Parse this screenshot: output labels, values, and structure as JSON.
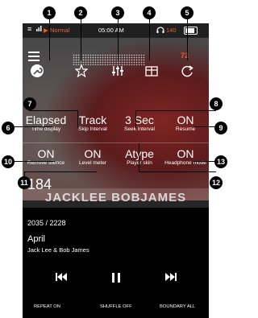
{
  "status": {
    "list_icon": "list-icon",
    "signal_icon": "signal-icon",
    "play_icon": "play-indicator-icon",
    "mode": "Normal",
    "time": "05:00 AM",
    "headphone_icon": "headphone-icon",
    "battery_level": "140",
    "battery_icon": "battery-icon"
  },
  "icons": {
    "icon1": "wrench-icon",
    "icon2": "star-icon",
    "icon3": "equalizer-icon",
    "icon4": "layout-icon",
    "icon5": "refresh-icon"
  },
  "overlay": {
    "right_number": "72"
  },
  "settings": {
    "time_display": {
      "value": "Elapsed",
      "label": "Time display"
    },
    "skip_interval": {
      "value": "Track",
      "label": "Skip Interval"
    },
    "seek_interval": {
      "value": "3 Sec",
      "label": "Seek Interval"
    },
    "resume": {
      "value": "ON",
      "label": "Resume"
    },
    "remove_silence": {
      "value": "ON",
      "label": "Remove silence"
    },
    "level_meter": {
      "value": "ON",
      "label": "Level meter"
    },
    "player_skin": {
      "value": "Atype",
      "label": "Player skin"
    },
    "headphone_mode": {
      "value": "ON",
      "label": "Headphone mode"
    }
  },
  "art_text": {
    "number": "184",
    "band": "JACKLEE BOBJAMES"
  },
  "track": {
    "counter": "2035 / 2228",
    "title": "April",
    "artist": "Jack Lee & Bob James"
  },
  "controls": {
    "prev_icon": "previous-icon",
    "pause_icon": "pause-icon",
    "next_icon": "next-icon",
    "repeat": "REPEAT ON",
    "shuffle": "SHUFFLE OFF",
    "boundary": "BOUNDARY ALL"
  },
  "callouts": [
    "1",
    "2",
    "3",
    "4",
    "5",
    "6",
    "7",
    "8",
    "9",
    "10",
    "11",
    "12",
    "13"
  ]
}
